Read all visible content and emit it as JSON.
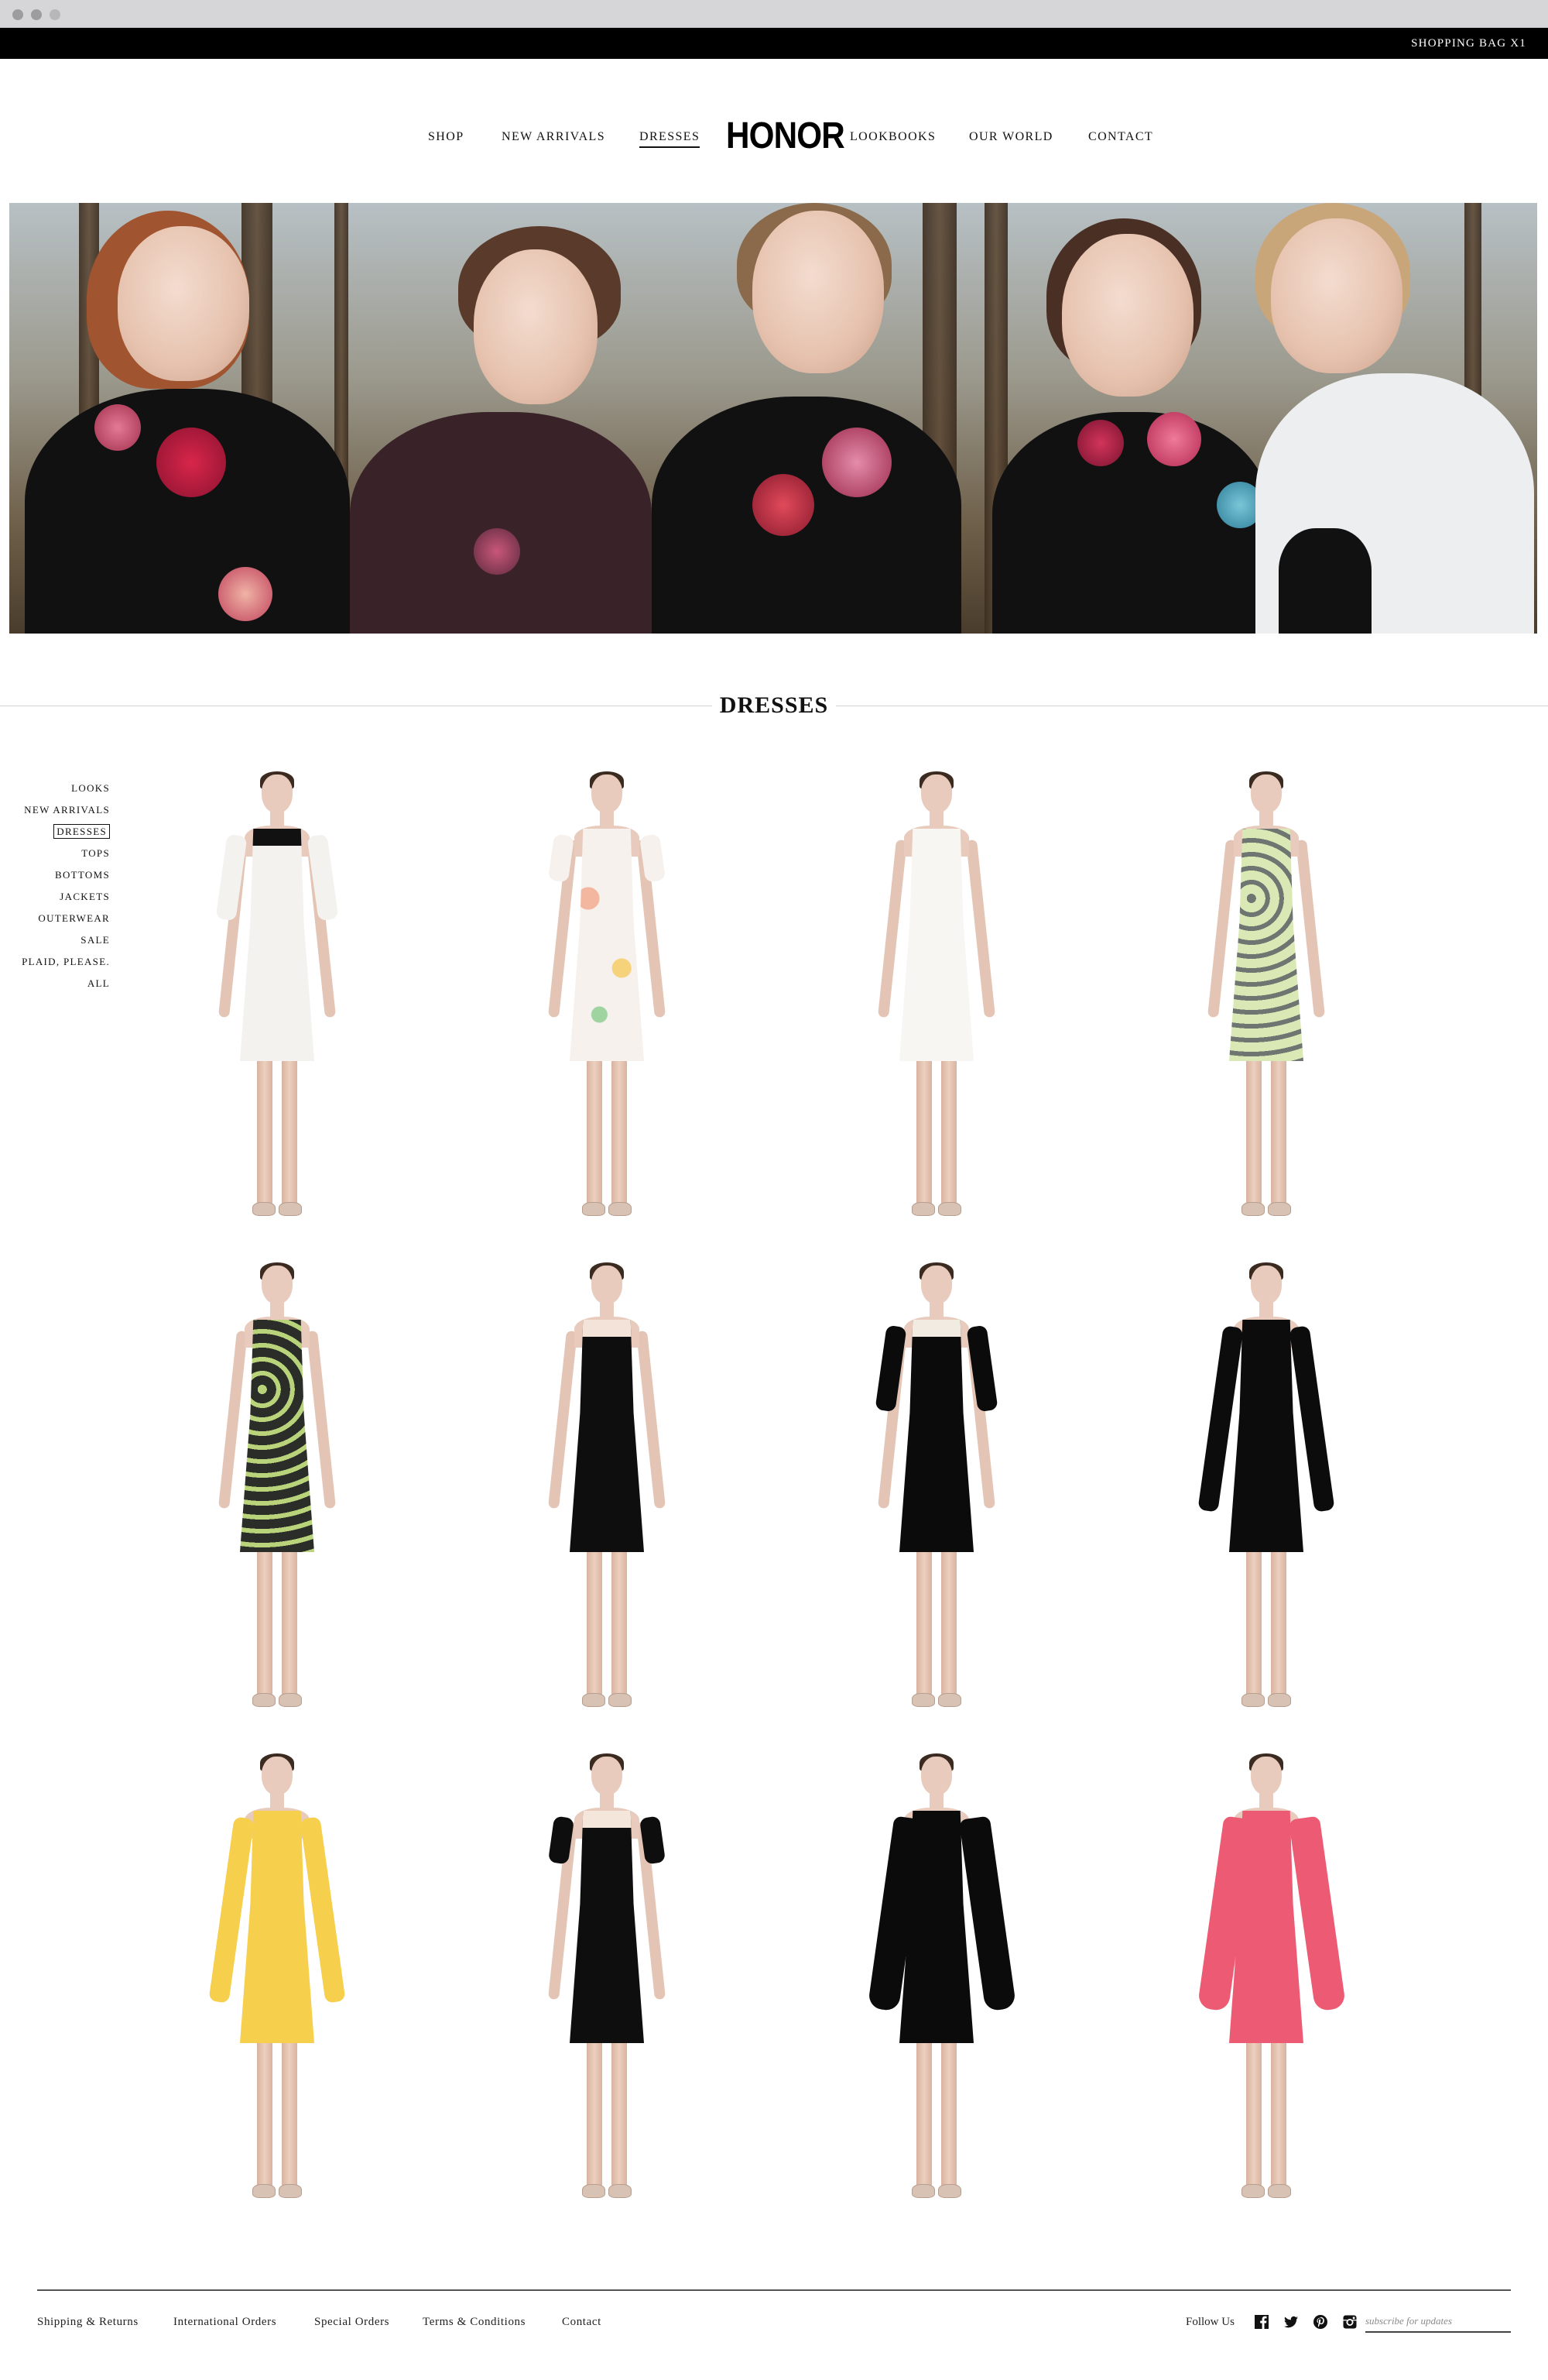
{
  "header": {
    "shopping_bag": "SHOPPING BAG X1"
  },
  "nav": {
    "logo": "HONOR",
    "items": [
      "SHOP",
      "NEW ARRIVALS",
      "DRESSES",
      "LOOKBOOKS",
      "OUR WORLD",
      "CONTACT"
    ],
    "active": "DRESSES"
  },
  "section": {
    "title": "DRESSES"
  },
  "sidebar": {
    "items": [
      "LOOKS",
      "NEW ARRIVALS",
      "DRESSES",
      "TOPS",
      "BOTTOMS",
      "JACKETS",
      "OUTERWEAR",
      "SALE",
      "PLAID, PLEASE.",
      "ALL"
    ],
    "active": "DRESSES"
  },
  "products": [
    {
      "style": "white lace dress with black bow",
      "dress_color": "#f4f2ee",
      "accent": "#111111",
      "sleeve": "elbow"
    },
    {
      "style": "white dress with pastel floral appliqué",
      "dress_color": "#f6f1ec",
      "accent": "#f2b79e",
      "sleeve": "short"
    },
    {
      "style": "white sleeveless dress with appliqué",
      "dress_color": "#f7f6f3",
      "accent": "#e9e2da",
      "sleeve": "none"
    },
    {
      "style": "lime and grey geometric print shift dress",
      "dress_color": "#d9e8b4",
      "accent": "#6f7672",
      "sleeve": "none"
    },
    {
      "style": "black and lime geometric print sleeveless dress",
      "dress_color": "#2a2d28",
      "accent": "#b9d37a",
      "sleeve": "none"
    },
    {
      "style": "black sleeveless dress with sheer yoke",
      "dress_color": "#0e0e0e",
      "accent": "#f3e3d8",
      "sleeve": "none"
    },
    {
      "style": "black dress with pearl collar",
      "dress_color": "#0b0b0b",
      "accent": "#f1ebe2",
      "sleeve": "elbow"
    },
    {
      "style": "black long sleeve shift dress",
      "dress_color": "#0c0c0c",
      "accent": "#0c0c0c",
      "sleeve": "long"
    },
    {
      "style": "yellow long sleeve shift dress",
      "dress_color": "#f6cf4c",
      "accent": "#f6cf4c",
      "sleeve": "long"
    },
    {
      "style": "black short sleeve dress with sheer yoke",
      "dress_color": "#0e0e0e",
      "accent": "#f5e6dc",
      "sleeve": "short"
    },
    {
      "style": "black bell sleeve dress",
      "dress_color": "#0b0b0b",
      "accent": "#0b0b0b",
      "sleeve": "bell"
    },
    {
      "style": "pink bell sleeve dress",
      "dress_color": "#ec5a73",
      "accent": "#ec5a73",
      "sleeve": "bell"
    }
  ],
  "footer": {
    "links": [
      "Shipping & Returns",
      "International Orders",
      "Special Orders",
      "Terms & Conditions",
      "Contact"
    ],
    "follow": "Follow Us",
    "social_icons": [
      "facebook-icon",
      "twitter-icon",
      "pinterest-icon",
      "instagram-icon"
    ],
    "subscribe_placeholder": "subscribe for updates"
  }
}
